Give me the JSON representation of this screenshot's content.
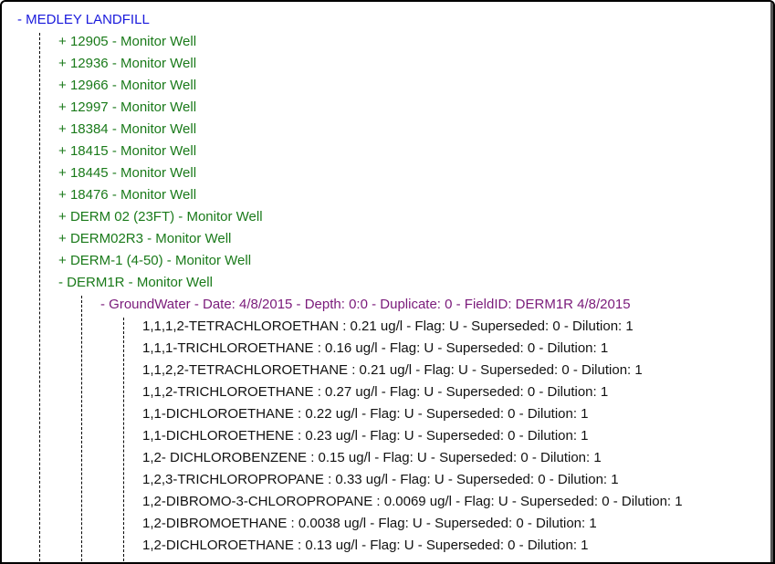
{
  "tree": {
    "root": {
      "prefix": "- ",
      "label": "MEDLEY LANDFILL"
    },
    "wells": [
      {
        "prefix": "+ ",
        "label": "12905 - Monitor Well"
      },
      {
        "prefix": "+ ",
        "label": "12936 - Monitor Well"
      },
      {
        "prefix": "+ ",
        "label": "12966 - Monitor Well"
      },
      {
        "prefix": "+ ",
        "label": "12997 - Monitor Well"
      },
      {
        "prefix": "+ ",
        "label": "18384 - Monitor Well"
      },
      {
        "prefix": "+ ",
        "label": "18415 - Monitor Well"
      },
      {
        "prefix": "+ ",
        "label": "18445 - Monitor Well"
      },
      {
        "prefix": "+ ",
        "label": "18476 - Monitor Well"
      },
      {
        "prefix": "+ ",
        "label": "DERM 02 (23FT) - Monitor Well"
      },
      {
        "prefix": "+ ",
        "label": "DERM02R3 - Monitor Well"
      },
      {
        "prefix": "+ ",
        "label": "DERM-1 (4-50) - Monitor Well"
      },
      {
        "prefix": "- ",
        "label": "DERM1R - Monitor Well"
      }
    ],
    "sample": {
      "prefix": "- ",
      "label": "GroundWater - Date: 4/8/2015 - Depth: 0:0 - Duplicate: 0 - FieldID: DERM1R 4/8/2015"
    },
    "results": [
      "1,1,1,2-TETRACHLOROETHAN : 0.21 ug/l - Flag: U - Superseded: 0 - Dilution: 1",
      "1,1,1-TRICHLOROETHANE : 0.16 ug/l - Flag: U - Superseded: 0 - Dilution: 1",
      "1,1,2,2-TETRACHLOROETHANE : 0.21 ug/l - Flag: U - Superseded: 0 - Dilution: 1",
      "1,1,2-TRICHLOROETHANE : 0.27 ug/l - Flag: U - Superseded: 0 - Dilution: 1",
      "1,1-DICHLOROETHANE : 0.22 ug/l - Flag: U - Superseded: 0 - Dilution: 1",
      "1,1-DICHLOROETHENE : 0.23 ug/l - Flag: U - Superseded: 0 - Dilution: 1",
      "1,2- DICHLOROBENZENE : 0.15 ug/l - Flag: U - Superseded: 0 - Dilution: 1",
      "1,2,3-TRICHLOROPROPANE : 0.33 ug/l - Flag: U - Superseded: 0 - Dilution: 1",
      "1,2-DIBROMO-3-CHLOROPROPANE : 0.0069 ug/l - Flag: U - Superseded: 0 - Dilution: 1",
      "1,2-DIBROMOETHANE : 0.0038 ug/l - Flag: U - Superseded: 0 - Dilution: 1",
      "1,2-DICHLOROETHANE : 0.13 ug/l - Flag: U - Superseded: 0 - Dilution: 1"
    ]
  },
  "colors": {
    "root": "#1a1adc",
    "well": "#1a7a1a",
    "sample": "#7a1a7a",
    "result": "#111111"
  }
}
